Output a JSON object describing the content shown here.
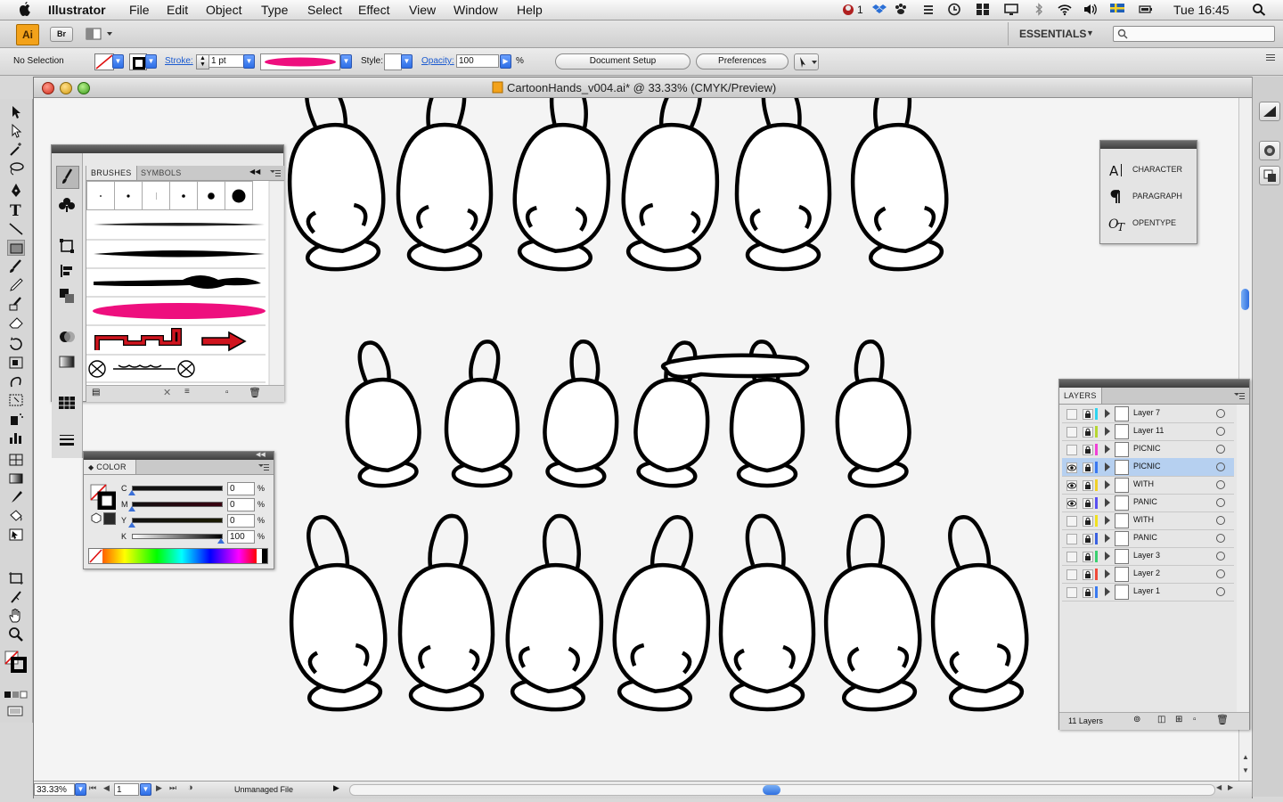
{
  "menubar": {
    "app_name": "Illustrator",
    "items": [
      "File",
      "Edit",
      "Object",
      "Type",
      "Select",
      "Effect",
      "View",
      "Window",
      "Help"
    ],
    "tray_badge": "1",
    "clock": "Tue 16:45"
  },
  "appbar": {
    "logo": "Ai",
    "bridge_label": "Br",
    "workspace": "ESSENTIALS",
    "workspace_arrow": "▼",
    "search_placeholder": ""
  },
  "controlbar": {
    "selection": "No Selection",
    "stroke_label": "Stroke:",
    "stroke_value": "1 pt",
    "style_label": "Style:",
    "opacity_label": "Opacity:",
    "opacity_value": "100",
    "opacity_unit": "%",
    "doc_setup": "Document Setup",
    "preferences": "Preferences",
    "brush_color": "#ee0f7e"
  },
  "document": {
    "title": "CartoonHands_v004.ai* @ 33.33% (CMYK/Preview)",
    "zoom": "33.33%",
    "artboard": "1",
    "status": "Unmanaged File"
  },
  "brushes_panel": {
    "tabs": [
      "BRUSHES",
      "SYMBOLS"
    ],
    "accent_pink": "#ee0f7e",
    "accent_red": "#d0141e"
  },
  "color_panel": {
    "title": "COLOR",
    "channels": [
      {
        "name": "C",
        "value": "0",
        "unit": "%"
      },
      {
        "name": "M",
        "value": "0",
        "unit": "%"
      },
      {
        "name": "Y",
        "value": "0",
        "unit": "%"
      },
      {
        "name": "K",
        "value": "100",
        "unit": "%"
      }
    ]
  },
  "type_panel": {
    "items": [
      {
        "icon": "character-icon",
        "label": "CHARACTER"
      },
      {
        "icon": "paragraph-icon",
        "label": "PARAGRAPH"
      },
      {
        "icon": "opentype-icon",
        "label": "OPENTYPE"
      }
    ]
  },
  "layers_panel": {
    "title": "LAYERS",
    "count_label": "11 Layers",
    "layers": [
      {
        "name": "Layer 7",
        "color": "#2fd4f0",
        "visible": false,
        "selected": false
      },
      {
        "name": "Layer 11",
        "color": "#b6d632",
        "visible": false,
        "selected": false
      },
      {
        "name": "PICNIC",
        "color": "#f040d8",
        "visible": false,
        "selected": false
      },
      {
        "name": "PICNIC",
        "color": "#3a78f0",
        "visible": true,
        "selected": true
      },
      {
        "name": "WITH",
        "color": "#f0d028",
        "visible": true,
        "selected": false
      },
      {
        "name": "PANIC",
        "color": "#5a50f0",
        "visible": true,
        "selected": false
      },
      {
        "name": "WITH",
        "color": "#f0e020",
        "visible": false,
        "selected": false
      },
      {
        "name": "PANIC",
        "color": "#3a60e0",
        "visible": false,
        "selected": false
      },
      {
        "name": "Layer 3",
        "color": "#3ad070",
        "visible": false,
        "selected": false
      },
      {
        "name": "Layer 2",
        "color": "#f04a3a",
        "visible": false,
        "selected": false
      },
      {
        "name": "Layer 1",
        "color": "#3a7af0",
        "visible": false,
        "selected": false
      }
    ]
  }
}
